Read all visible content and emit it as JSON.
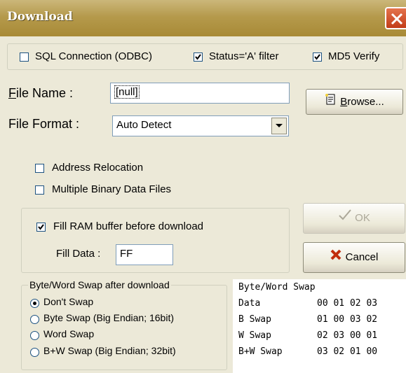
{
  "window": {
    "title": "Download"
  },
  "options": {
    "sql_connection": {
      "label": "SQL Connection (ODBC)",
      "checked": false
    },
    "status_filter": {
      "label": "Status='A' filter",
      "checked": true
    },
    "md5_verify": {
      "label": "MD5 Verify",
      "checked": true
    }
  },
  "file": {
    "name_label_u": "F",
    "name_label_rest": "ile Name :",
    "name_value": "[null]",
    "format_label": "File Format :",
    "format_value": "Auto Detect"
  },
  "buttons": {
    "browse_u": "B",
    "browse_rest": "rowse...",
    "ok": "OK",
    "cancel": "Cancel"
  },
  "checks": {
    "address_relocation": {
      "label": "Address Relocation",
      "checked": false
    },
    "multiple_binary": {
      "label": "Multiple Binary Data Files",
      "checked": false
    },
    "fill_ram": {
      "label": "Fill RAM buffer before download",
      "checked": true
    }
  },
  "fill": {
    "label": "Fill Data :",
    "value": "FF"
  },
  "swap": {
    "legend": "Byte/Word Swap after download",
    "options": [
      {
        "label": "Don't Swap",
        "selected": true
      },
      {
        "label": "Byte Swap (Big Endian; 16bit)",
        "selected": false
      },
      {
        "label": "Word Swap",
        "selected": false
      },
      {
        "label": "B+W Swap (Big Endian; 32bit)",
        "selected": false
      }
    ]
  },
  "swap_table": {
    "title": "Byte/Word Swap",
    "rows": [
      {
        "label": "Data",
        "values": "00 01 02 03"
      },
      {
        "label": "B Swap",
        "values": "01 00 03 02"
      },
      {
        "label": "W Swap",
        "values": "02 03 00 01"
      },
      {
        "label": "B+W Swap",
        "values": "03 02 01 00"
      }
    ]
  }
}
